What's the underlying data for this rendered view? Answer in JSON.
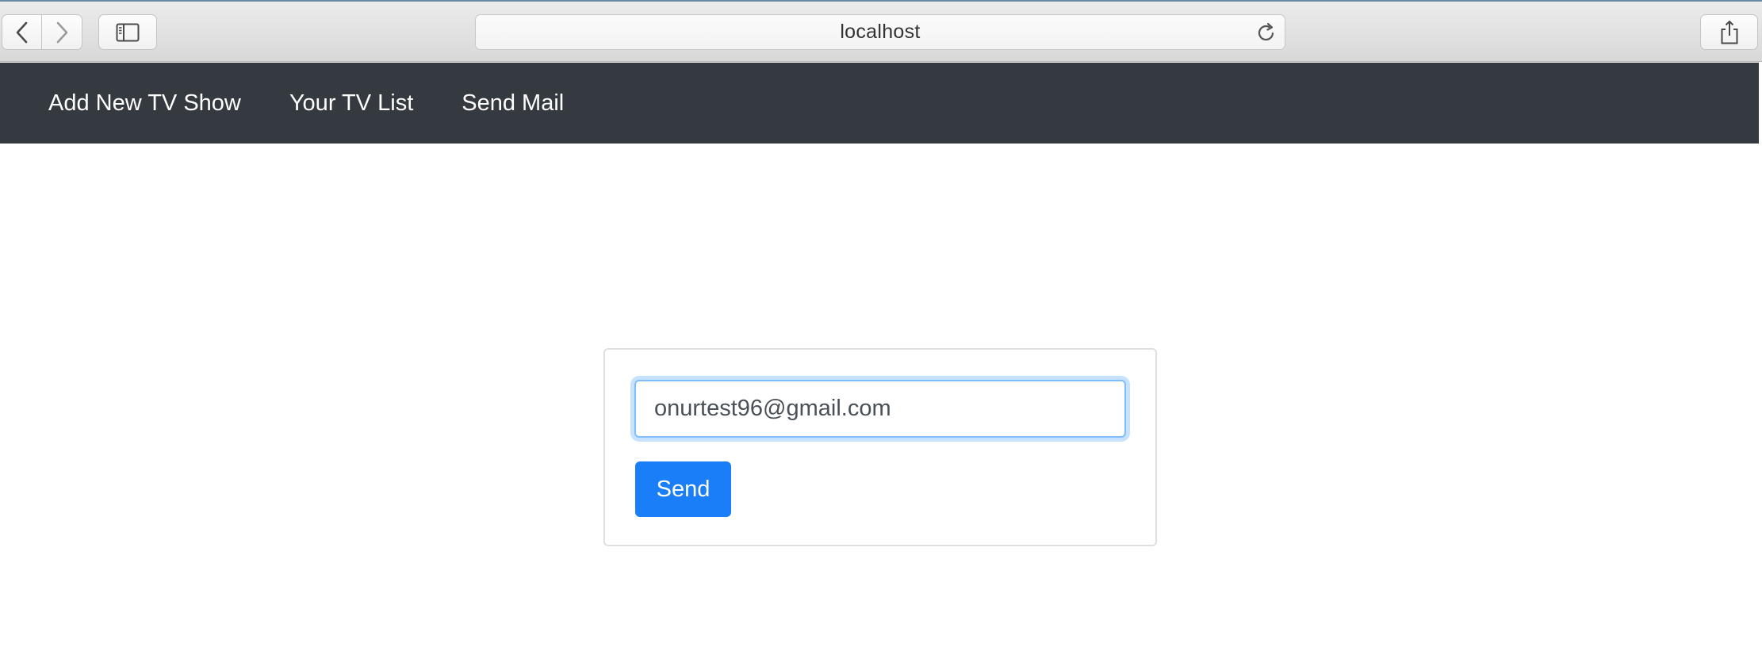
{
  "browser": {
    "url": "localhost",
    "icons": {
      "back": "chevron-left-icon",
      "forward": "chevron-right-icon",
      "sidebar": "sidebar-icon",
      "reload": "reload-icon",
      "share": "share-icon"
    }
  },
  "navbar": {
    "background": "#343a40",
    "links": [
      "Add New TV Show",
      "Your TV List",
      "Send Mail"
    ]
  },
  "mail_form": {
    "email_value": "onurtest96@gmail.com",
    "send_label": "Send",
    "accent": "#1a7ef8"
  }
}
